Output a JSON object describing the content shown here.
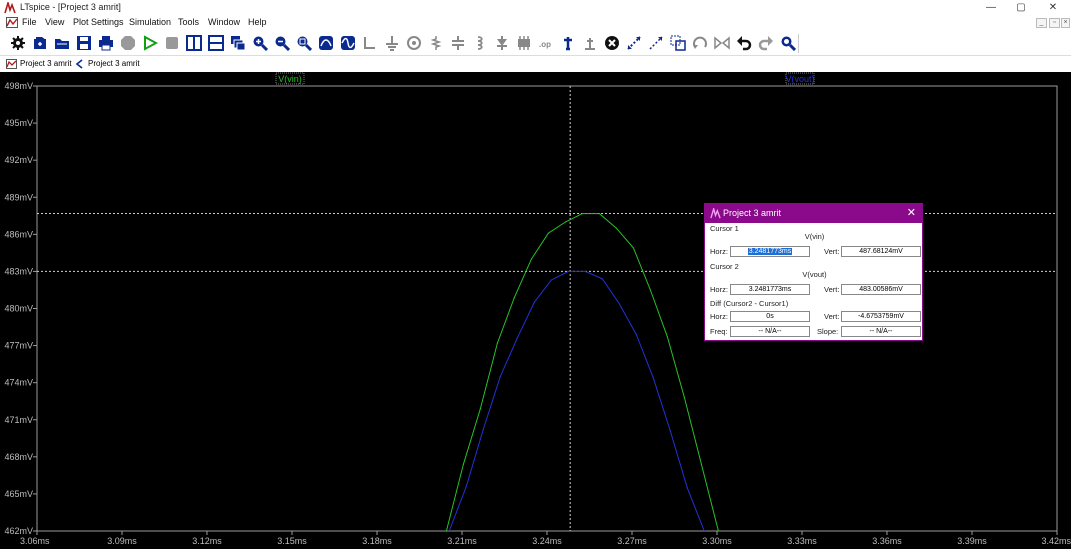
{
  "window": {
    "title": "LTspice - [Project 3 amrit]",
    "minimize": "—",
    "restore": "▢",
    "close": "✕"
  },
  "menu": [
    "File",
    "View",
    "Plot Settings",
    "Simulation",
    "Tools",
    "Window",
    "Help"
  ],
  "mdi": {
    "minimize": "_",
    "restore": "▫",
    "close": "×"
  },
  "toolbar": [
    "gear-icon",
    "open-schematic-icon",
    "open-folder-icon",
    "save-icon",
    "print-icon",
    "halt-icon",
    "run-icon",
    "stop-icon",
    "tile-vertical-icon",
    "tile-horizontal-icon",
    "cascade-icon",
    "zoom-in-icon",
    "zoom-out-icon",
    "zoom-fit-icon",
    "autorange-icon",
    "waveform-icon",
    "wire-icon",
    "ground-icon",
    "component-icon",
    "resistor-icon",
    "capacitor-icon",
    "inductor-icon",
    "diode-icon",
    "component-lib-icon",
    "spice-directive-icon",
    "text-icon",
    "label-icon",
    "delete-icon",
    "move-icon",
    "drag-icon",
    "duplicate-icon",
    "rotate-icon",
    "mirror-icon",
    "undo-icon",
    "redo-icon",
    "find-icon"
  ],
  "tabs": [
    {
      "label": "Project 3 amrit"
    },
    {
      "label": "Project 3 amrit"
    }
  ],
  "colors": {
    "vin": "#27c227",
    "vout": "#2332d6",
    "dialog": "#8b0a8b"
  },
  "chart_data": {
    "type": "line",
    "title": "",
    "xlabel": "",
    "ylabel": "",
    "xlim": [
      3.06,
      3.42
    ],
    "ylim": [
      462,
      498
    ],
    "x_unit": "ms",
    "y_unit": "mV",
    "x_ticks": [
      "3.06ms",
      "3.09ms",
      "3.12ms",
      "3.15ms",
      "3.18ms",
      "3.21ms",
      "3.24ms",
      "3.27ms",
      "3.30ms",
      "3.33ms",
      "3.36ms",
      "3.39ms",
      "3.42ms"
    ],
    "y_ticks": [
      "498mV",
      "495mV",
      "492mV",
      "489mV",
      "486mV",
      "483mV",
      "480mV",
      "477mV",
      "474mV",
      "471mV",
      "468mV",
      "465mV",
      "462mV"
    ],
    "grid": false,
    "legend": "top",
    "series": [
      {
        "name": "V(vin)",
        "x": [
          3.2045,
          3.2105,
          3.2165,
          3.2225,
          3.2285,
          3.2345,
          3.2405,
          3.2465,
          3.2525,
          3.2585,
          3.2645,
          3.2705,
          3.2765,
          3.2825,
          3.2885,
          3.2945,
          3.3005
        ],
        "y": [
          462.0,
          467.4,
          471.9,
          477.2,
          480.9,
          484.0,
          486.1,
          487.0,
          487.68,
          487.68,
          486.5,
          484.9,
          481.5,
          477.7,
          472.8,
          467.4,
          462.0
        ]
      },
      {
        "name": "V(vout)",
        "x": [
          3.2055,
          3.2115,
          3.2175,
          3.2235,
          3.2295,
          3.2355,
          3.2415,
          3.2475,
          3.2535,
          3.2595,
          3.2655,
          3.2715,
          3.2775,
          3.2835,
          3.2895,
          3.2955
        ],
        "y": [
          462.0,
          465.6,
          470.2,
          474.5,
          477.6,
          480.5,
          482.3,
          483.0,
          483.0,
          482.4,
          480.4,
          477.9,
          474.4,
          470.1,
          465.5,
          462.0
        ]
      }
    ],
    "cursor": {
      "x": 3.2481773,
      "y1": 487.68124,
      "y2": 483.00586
    }
  },
  "dialog": {
    "title": "Project 3 amrit",
    "close": "✕",
    "cursor1": {
      "label": "Cursor 1",
      "trace": "V(vin)",
      "horz_label": "Horz:",
      "horz": "3.2481773ms",
      "vert_label": "Vert:",
      "vert": "487.68124mV"
    },
    "cursor2": {
      "label": "Cursor 2",
      "trace": "V(vout)",
      "horz_label": "Horz:",
      "horz": "3.2481773ms",
      "vert_label": "Vert:",
      "vert": "483.00586mV"
    },
    "diff": {
      "label": "Diff (Cursor2 - Cursor1)",
      "horz_label": "Horz:",
      "horz": "0s",
      "vert_label": "Vert:",
      "vert": "-4.6753759mV",
      "freq_label": "Freq:",
      "freq": "-- N/A--",
      "slope_label": "Slope:",
      "slope": "-- N/A--"
    }
  }
}
